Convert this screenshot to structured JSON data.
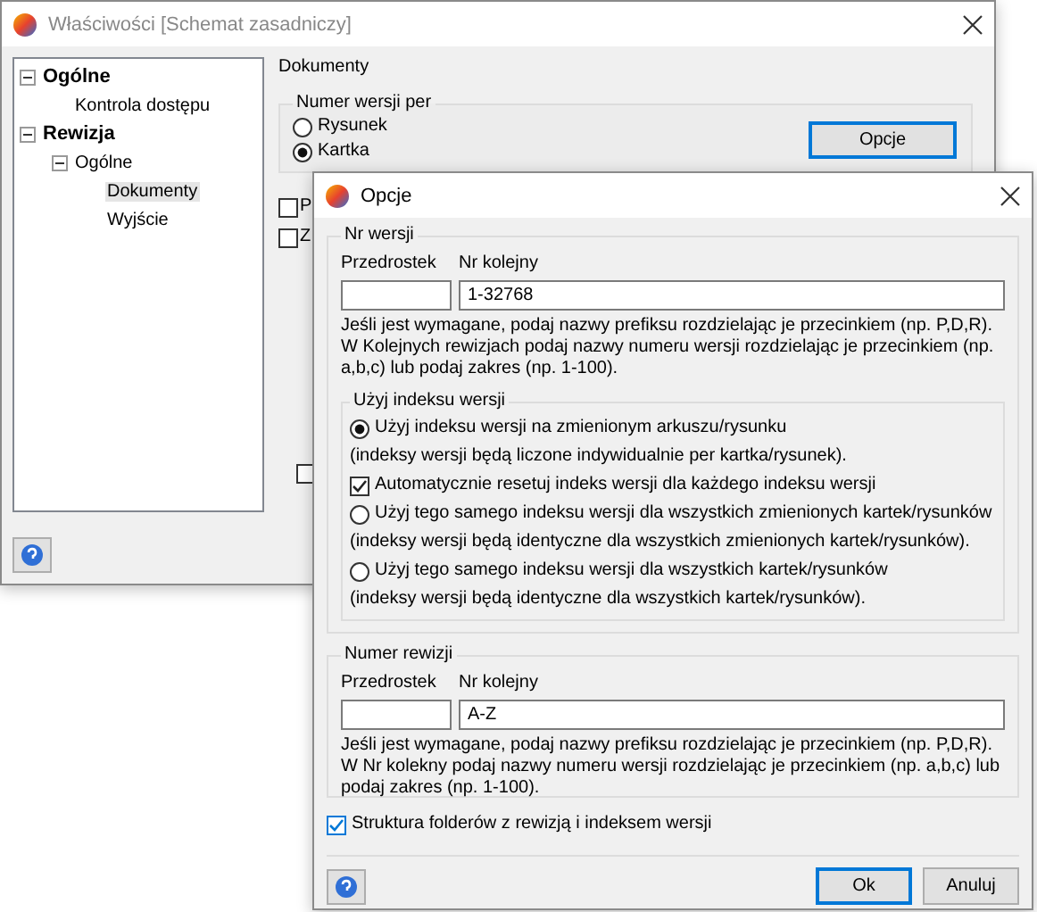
{
  "main_window": {
    "title": "Właściwości [Schemat zasadniczy]",
    "tree": [
      {
        "label": "Ogólne",
        "expanded": true,
        "selected": false,
        "children": [
          {
            "label": "Kontrola dostępu",
            "selected": false
          }
        ]
      },
      {
        "label": "Rewizja",
        "expanded": true,
        "selected": false,
        "children": [
          {
            "label": "Ogólne",
            "expanded": true,
            "selected": false,
            "children": [
              {
                "label": "Dokumenty",
                "selected": true
              },
              {
                "label": "Wyjście",
                "selected": false
              }
            ]
          }
        ]
      }
    ],
    "section_title": "Dokumenty",
    "version_group": {
      "title": "Numer wersji per",
      "options": [
        {
          "label": "Rysunek",
          "selected": false
        },
        {
          "label": "Kartka",
          "selected": true
        }
      ],
      "button": "Opcje"
    },
    "checkboxes": [
      {
        "label": "P",
        "checked": false
      },
      {
        "label": "Z",
        "checked": false
      },
      {
        "checked": false
      }
    ]
  },
  "dialog": {
    "title": "Opcje",
    "version_group": {
      "title": "Nr wersji",
      "prefix_label": "Przedrostek",
      "number_label": "Nr kolejny",
      "number_value": "1-32768",
      "help": "Jeśli jest wymagane, podaj nazwy prefiksu rozdzielając je przecinkiem (np. P,D,R). W Kolejnych rewizjach podaj nazwy numeru wersji rozdzielając je przecinkiem (np. a,b,c) lub podaj zakres (np. 1-100).",
      "index_group": {
        "title": "Użyj indeksu wersji",
        "items": [
          {
            "kind": "radio",
            "label": "Użyj indeksu wersji na zmienionym arkuszu/rysunku",
            "selected": true
          },
          {
            "kind": "note",
            "label": "(indeksy wersji będą liczone indywidualnie per kartka/rysunek)."
          },
          {
            "kind": "checkbox",
            "label": "Automatycznie resetuj indeks wersji dla każdego indeksu wersji",
            "checked": true
          },
          {
            "kind": "radio",
            "label": "Użyj tego samego indeksu wersji dla wszystkich zmienionych kartek/rysunków",
            "selected": false
          },
          {
            "kind": "note",
            "label": "(indeksy wersji będą identyczne dla wszystkich zmienionych kartek/rysunków)."
          },
          {
            "kind": "radio",
            "label": "Użyj tego samego indeksu wersji dla wszystkich kartek/rysunków",
            "selected": false
          },
          {
            "kind": "note",
            "label": "(indeksy wersji będą identyczne dla wszystkich kartek/rysunków)."
          }
        ]
      }
    },
    "revision_group": {
      "title": "Numer rewizji",
      "prefix_label": "Przedrostek",
      "number_label": "Nr kolejny",
      "number_value": "A-Z",
      "help": "Jeśli jest wymagane, podaj nazwy prefiksu rozdzielając je przecinkiem (np. P,D,R). W Nr kolekny podaj nazwy numeru wersji rozdzielając je przecinkiem (np. a,b,c) lub podaj zakres (np. 1-100)."
    },
    "folder_checkbox": {
      "label": "Struktura folderów z rewizją i indeksem wersji",
      "checked": true
    },
    "buttons": [
      {
        "label": "Ok",
        "default": true
      },
      {
        "label": "Anuluj",
        "default": false
      }
    ]
  }
}
